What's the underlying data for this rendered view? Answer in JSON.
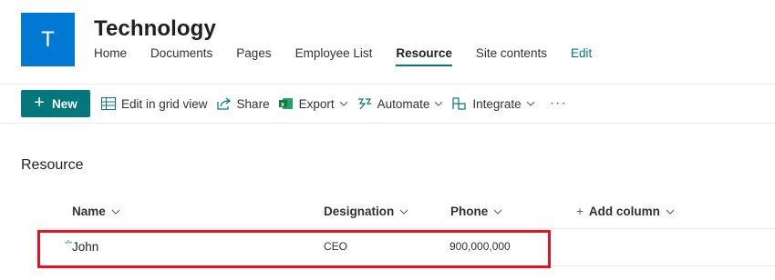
{
  "site": {
    "logo_letter": "T",
    "title": "Technology",
    "nav": [
      "Home",
      "Documents",
      "Pages",
      "Employee List",
      "Resource",
      "Site contents"
    ],
    "nav_active": "Resource",
    "edit_label": "Edit"
  },
  "commands": {
    "new_label": "New",
    "edit_grid_label": "Edit in grid view",
    "share_label": "Share",
    "export_label": "Export",
    "automate_label": "Automate",
    "integrate_label": "Integrate",
    "more_label": "···"
  },
  "list": {
    "title": "Resource",
    "columns": {
      "name": "Name",
      "designation": "Designation",
      "phone": "Phone",
      "add_column": "Add column"
    },
    "rows": [
      {
        "name": "John",
        "designation": "CEO",
        "phone": "900,000,000"
      }
    ]
  },
  "colors": {
    "brand_blue": "#0078d4",
    "theme_teal": "#03787c",
    "highlight_red": "#e81123"
  }
}
